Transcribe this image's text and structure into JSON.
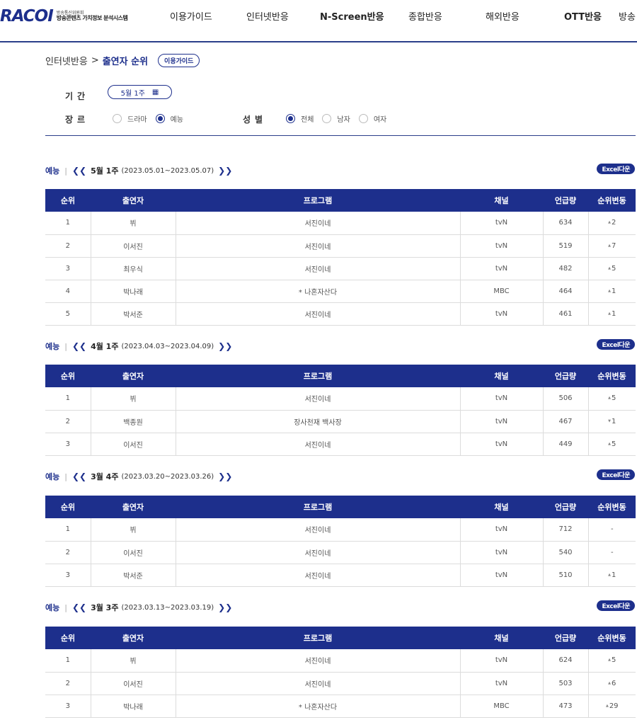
{
  "header": {
    "logo": "RACOI",
    "logo_sub1": "방송통신위원회",
    "logo_sub2": "방송콘텐츠 가치정보 분석시스템",
    "nav": [
      "이용가이드",
      "인터넷반응",
      "N-Screen반응",
      "종합반응",
      "해외반응",
      "OTT반응",
      "방송"
    ]
  },
  "breadcrumb": {
    "parent": "인터넷반응",
    "separator": ">",
    "current": "출연자 순위",
    "guide_button": "이용가이드"
  },
  "filters": {
    "period_label": "기간",
    "period_value": "5월 1주",
    "genre_label": "장르",
    "genre_options": [
      "드라마",
      "예능"
    ],
    "genre_selected": "예능",
    "gender_label": "성별",
    "gender_options": [
      "전체",
      "남자",
      "여자"
    ],
    "gender_selected": "전체"
  },
  "table_headers": [
    "순위",
    "출연자",
    "프로그램",
    "채널",
    "언급량",
    "순위변동"
  ],
  "excel_label": "Excel다운",
  "sections": [
    {
      "genre": "예능",
      "week": "5월 1주",
      "range": "(2023.05.01~2023.05.07)",
      "rows": [
        [
          "1",
          "뷔",
          "서진이네",
          "tvN",
          "634",
          "2"
        ],
        [
          "2",
          "이서진",
          "서진이네",
          "tvN",
          "519",
          "7"
        ],
        [
          "3",
          "최우식",
          "서진이네",
          "tvN",
          "482",
          "5"
        ],
        [
          "4",
          "박나래",
          "* 나혼자산다",
          "MBC",
          "464",
          "1"
        ],
        [
          "5",
          "박서준",
          "서진이네",
          "tvN",
          "461",
          "1"
        ]
      ],
      "changes": [
        "up",
        "up",
        "up",
        "up",
        "up"
      ]
    },
    {
      "genre": "예능",
      "week": "4월 1주",
      "range": "(2023.04.03~2023.04.09)",
      "rows": [
        [
          "1",
          "뷔",
          "서진이네",
          "tvN",
          "506",
          "5"
        ],
        [
          "2",
          "백종원",
          "장사천재 백사장",
          "tvN",
          "467",
          "1"
        ],
        [
          "3",
          "이서진",
          "서진이네",
          "tvN",
          "449",
          "5"
        ]
      ],
      "changes": [
        "up",
        "down",
        "up"
      ]
    },
    {
      "genre": "예능",
      "week": "3월 4주",
      "range": "(2023.03.20~2023.03.26)",
      "rows": [
        [
          "1",
          "뷔",
          "서진이네",
          "tvN",
          "712",
          "-"
        ],
        [
          "2",
          "이서진",
          "서진이네",
          "tvN",
          "540",
          "-"
        ],
        [
          "3",
          "박서준",
          "서진이네",
          "tvN",
          "510",
          "1"
        ]
      ],
      "changes": [
        "none",
        "none",
        "up"
      ]
    },
    {
      "genre": "예능",
      "week": "3월 3주",
      "range": "(2023.03.13~2023.03.19)",
      "rows": [
        [
          "1",
          "뷔",
          "서진이네",
          "tvN",
          "624",
          "5"
        ],
        [
          "2",
          "이서진",
          "서진이네",
          "tvN",
          "503",
          "6"
        ],
        [
          "3",
          "박나래",
          "* 나혼자산다",
          "MBC",
          "473",
          "29"
        ]
      ],
      "changes": [
        "up",
        "up",
        "up"
      ]
    }
  ]
}
